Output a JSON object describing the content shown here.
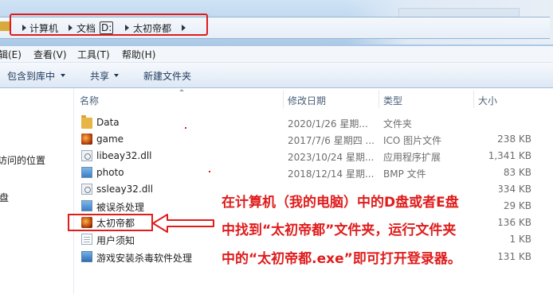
{
  "breadcrumb": {
    "items": [
      "计算机",
      "文档",
      "D:",
      "太初帝都"
    ]
  },
  "menu": {
    "items": [
      "编辑(E)",
      "查看(V)",
      "工具(T)",
      "帮助(H)"
    ]
  },
  "toolbar": {
    "include_library": "包含到库中",
    "share": "共享",
    "new_folder": "新建文件夹"
  },
  "nav": {
    "recent": "访问的位置",
    "disk": "盘"
  },
  "columns": {
    "name": "名称",
    "date": "修改日期",
    "type": "类型",
    "size": "大小"
  },
  "files": [
    {
      "name": "Data",
      "icon": "folder-icon",
      "date": "2020/1/26 星期...",
      "type": "文件夹",
      "size": ""
    },
    {
      "name": "game",
      "icon": "game-icon",
      "date": "2017/7/6 星期四 ...",
      "type": "ICO 图片文件",
      "size": "238 KB"
    },
    {
      "name": "libeay32.dll",
      "icon": "dll-icon",
      "date": "2023/10/24 星期...",
      "type": "应用程序扩展",
      "size": "1,341 KB"
    },
    {
      "name": "photo",
      "icon": "image-icon",
      "date": "2018/12/14 星期...",
      "type": "BMP 文件",
      "size": "83 KB"
    },
    {
      "name": "ssleay32.dll",
      "icon": "dll-icon",
      "date": "",
      "type": "",
      "size": "334 KB"
    },
    {
      "name": "被误杀处理",
      "icon": "image-icon",
      "date": "",
      "type": "",
      "size": "29 KB"
    },
    {
      "name": "太初帝都",
      "icon": "game-icon",
      "date": "",
      "type": "",
      "size": "136 KB"
    },
    {
      "name": "用户须知",
      "icon": "document-icon",
      "date": "",
      "type": "",
      "size": "1 KB"
    },
    {
      "name": "游戏安装杀毒软件处理",
      "icon": "application-icon",
      "date": "",
      "type": "",
      "size": "131 KB"
    }
  ],
  "annotation": {
    "lines": [
      "在计算机（我的电脑）中的D盘或者E盘",
      "中找到“太初帝都”文件夹，运行文件夹",
      "中的“太初帝都.exe”即可打开登录器。"
    ]
  },
  "colors": {
    "accent_red": "#e01c1c",
    "chrome_blue": "#b9d3ec"
  }
}
